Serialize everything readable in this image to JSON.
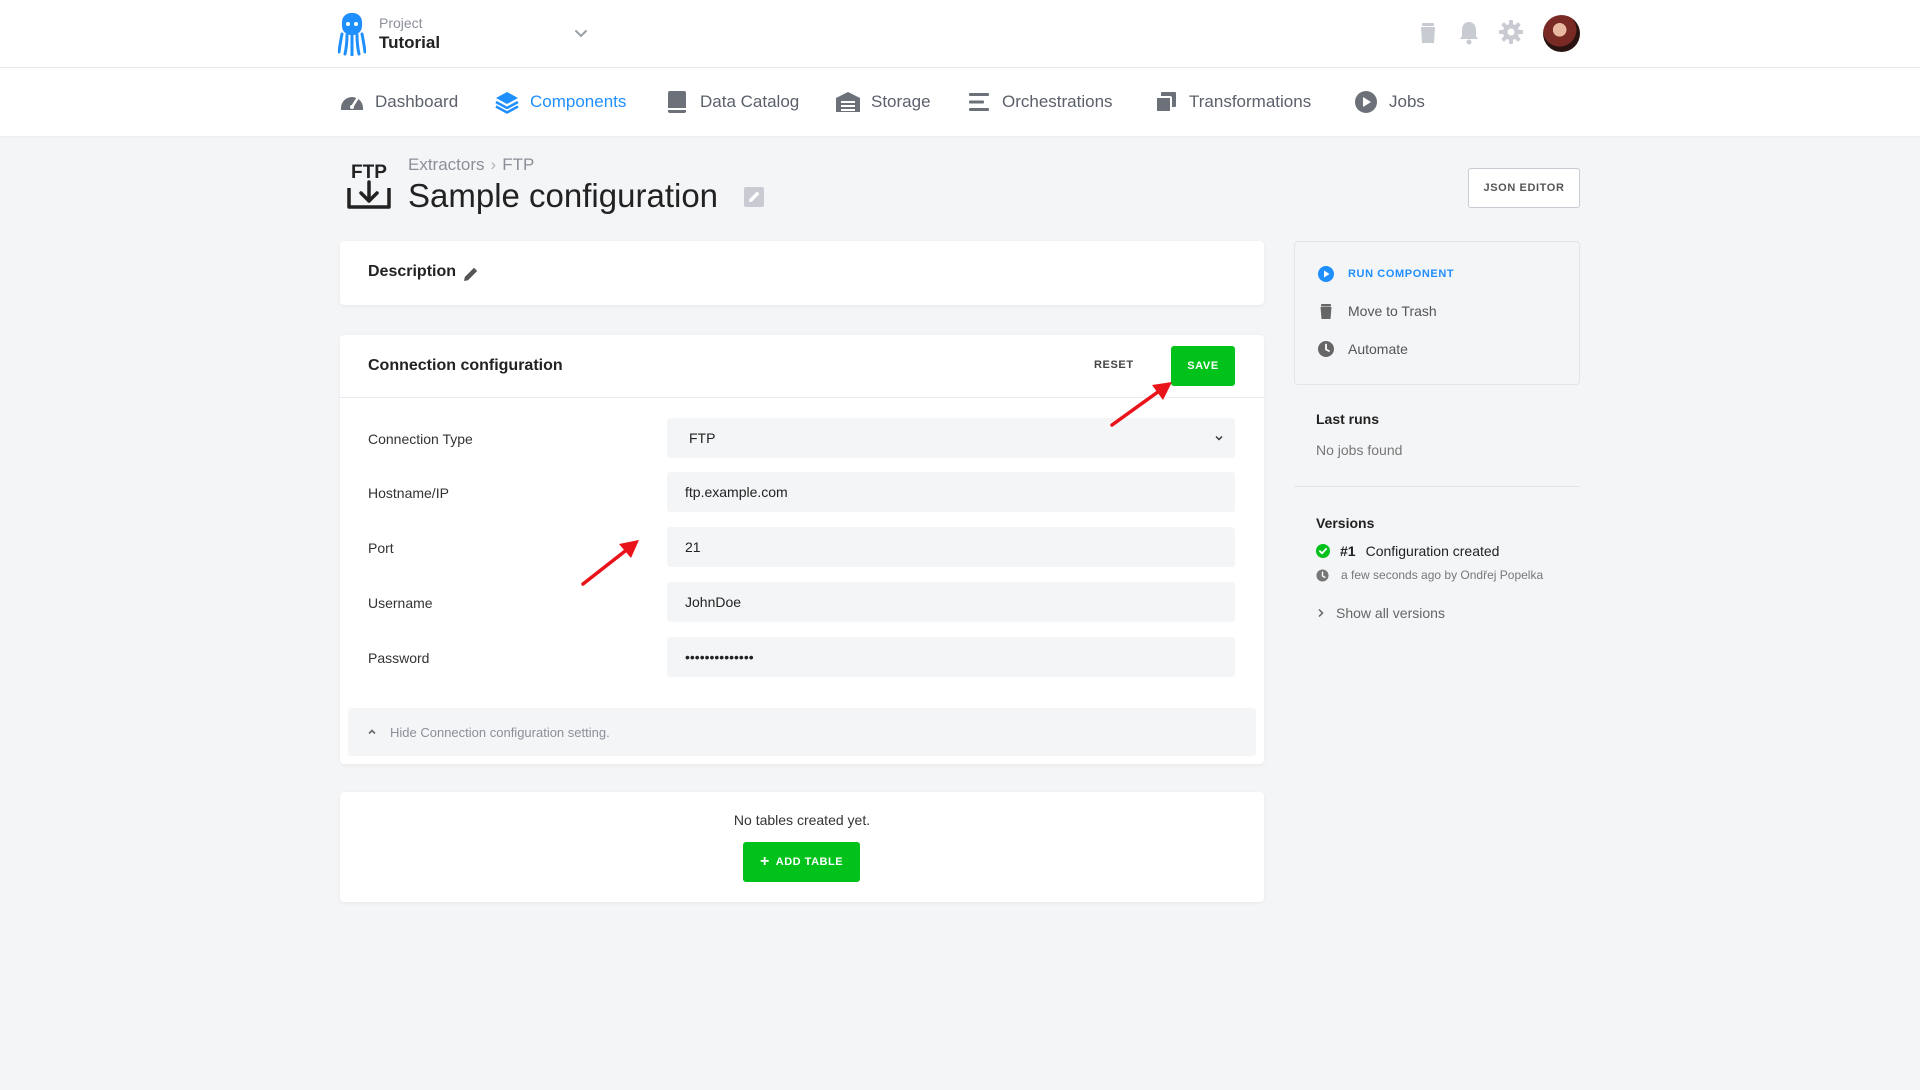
{
  "header": {
    "project_label": "Project",
    "project_name": "Tutorial",
    "icons": [
      "trash-icon",
      "bell-icon",
      "gear-icon"
    ]
  },
  "nav": {
    "items": [
      {
        "label": "Dashboard",
        "icon": "dashboard-icon"
      },
      {
        "label": "Components",
        "icon": "layers-icon",
        "active": true
      },
      {
        "label": "Data Catalog",
        "icon": "book-icon"
      },
      {
        "label": "Storage",
        "icon": "warehouse-icon"
      },
      {
        "label": "Orchestrations",
        "icon": "orchestration-icon"
      },
      {
        "label": "Transformations",
        "icon": "transformations-icon"
      },
      {
        "label": "Jobs",
        "icon": "play-icon"
      }
    ]
  },
  "page": {
    "breadcrumb": [
      "Extractors",
      "FTP"
    ],
    "breadcrumb_separator": "›",
    "title": "Sample configuration",
    "icon_text": "FTP",
    "json_editor_label": "JSON EDITOR"
  },
  "description": {
    "label": "Description"
  },
  "connection": {
    "title": "Connection configuration",
    "reset_label": "RESET",
    "save_label": "SAVE",
    "fields": [
      {
        "label": "Connection Type",
        "value": "FTP"
      },
      {
        "label": "Hostname/IP",
        "value": "ftp.example.com"
      },
      {
        "label": "Port",
        "value": "21"
      },
      {
        "label": "Username",
        "value": "JohnDoe"
      },
      {
        "label": "Password",
        "value": "••••••••••••••"
      }
    ],
    "hide_label": "Hide Connection configuration setting."
  },
  "tables": {
    "empty_text": "No tables created yet.",
    "add_label": "ADD TABLE"
  },
  "sidebar": {
    "actions": [
      {
        "label": "RUN COMPONENT",
        "icon": "play-circle-icon"
      },
      {
        "label": "Move to Trash",
        "icon": "trash-icon"
      },
      {
        "label": "Automate",
        "icon": "clock-icon"
      }
    ],
    "last_runs_title": "Last runs",
    "no_jobs": "No jobs found",
    "versions_title": "Versions",
    "version": {
      "number": "#1",
      "text": "Configuration created",
      "meta": "a few seconds ago by Ondřej Popelka"
    },
    "show_all": "Show all versions"
  },
  "colors": {
    "accent": "#1f8fff",
    "success": "#00c21a",
    "annotation_arrow": "#e8141a"
  }
}
